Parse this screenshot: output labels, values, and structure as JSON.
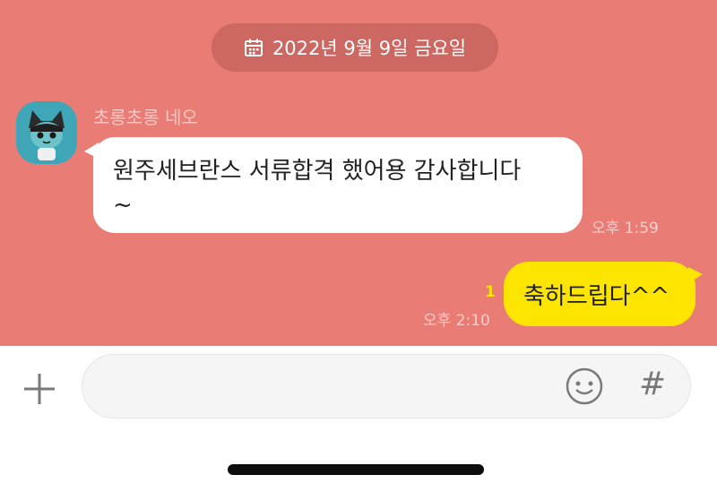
{
  "date_divider": {
    "text": "2022년 9월 9일 금요일",
    "icon": "calendar-icon"
  },
  "incoming": {
    "sender": "초롱초롱 네오",
    "avatar": "profile-avatar",
    "line1": "원주세브란스 서류합격 했어용 감사합니다",
    "line2": "~",
    "time": "오후 1:59"
  },
  "outgoing": {
    "text": "축하드립다^^",
    "unread_count": "1",
    "time": "오후 2:10"
  },
  "composer": {
    "plus_icon": "plus-icon",
    "emoji_icon": "emoji-icon",
    "hash_label": "#"
  },
  "colors": {
    "chat_background": "#e97c74",
    "outgoing_bubble": "#fee500",
    "incoming_bubble": "#ffffff"
  }
}
